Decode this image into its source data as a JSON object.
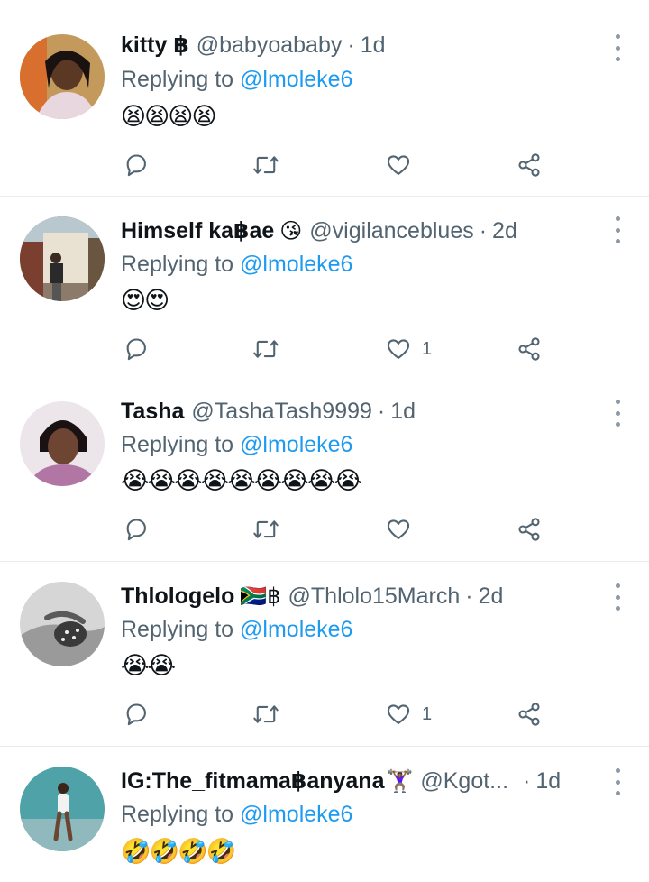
{
  "colors": {
    "accent": "#1d9bf0",
    "muted": "#536471",
    "divider": "#e6ecf0"
  },
  "icons": [
    "reply-icon",
    "retweet-icon",
    "like-icon",
    "share-icon",
    "more-options-icon"
  ],
  "tweets": [
    {
      "name": "kitty ฿",
      "badge": "",
      "handle": "@babyoababy",
      "dot": "·",
      "time": "1d",
      "reply_prefix": "Replying to",
      "mention": "@lmoleke6",
      "emojis": "😫😫😫😫",
      "likes": ""
    },
    {
      "name": "Himself ka฿ae",
      "badge": "😘",
      "handle": "@vigilanceblues",
      "dot": "·",
      "time": "2d",
      "reply_prefix": "Replying to",
      "mention": "@lmoleke6",
      "emojis": "😍😍",
      "likes": "1"
    },
    {
      "name": "Tasha",
      "badge": "",
      "handle": "@TashaTash9999",
      "dot": "·",
      "time": "1d",
      "reply_prefix": "Replying to",
      "mention": "@lmoleke6",
      "emojis": "😭😭😭😭😭😭😭😭😭",
      "likes": ""
    },
    {
      "name": "Thlologelo",
      "badge": "🇿🇦฿",
      "handle": "@Thlolo15March",
      "dot": "·",
      "time": "2d",
      "reply_prefix": "Replying to",
      "mention": "@lmoleke6",
      "emojis": "😭😭",
      "likes": "1"
    },
    {
      "name": "IG:The_fitmama฿anyana",
      "badge": "🏋🏾‍♀️",
      "handle": "@Kgot...",
      "dot": "·",
      "time": "1d",
      "reply_prefix": "Replying to",
      "mention": "@lmoleke6",
      "emojis": "🤣🤣🤣🤣",
      "likes": ""
    }
  ]
}
